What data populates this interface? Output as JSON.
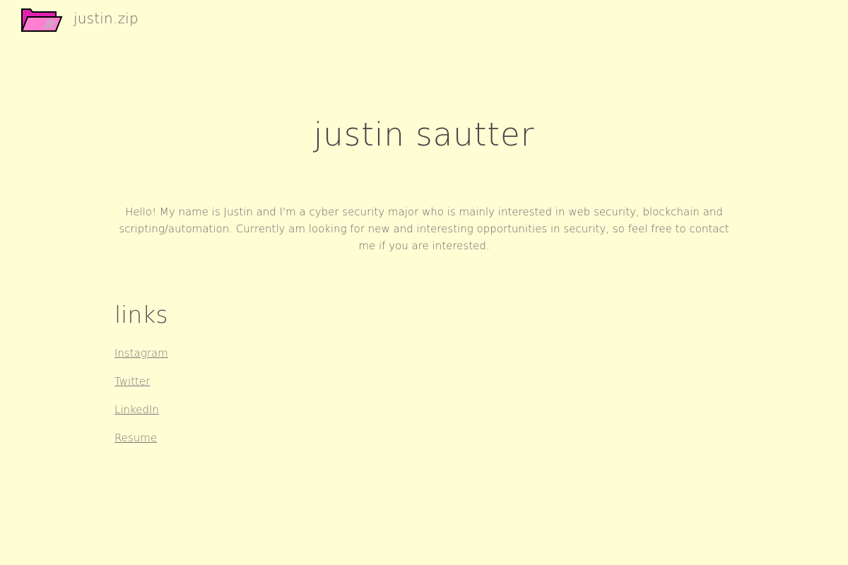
{
  "header": {
    "logo_icon": "open-folder-icon",
    "site_name": "justin.zip"
  },
  "main": {
    "title": "justin sautter",
    "intro": "Hello! My name is Justin and I'm a cyber security major who is mainly interested in web security, blockchain and scripting/automation.  Currently am looking for new and interesting opportunities in security, so feel free to contact me if you are interested.",
    "links_heading": "links",
    "links": [
      {
        "label": "Instagram"
      },
      {
        "label": "Twitter"
      },
      {
        "label": "LinkedIn"
      },
      {
        "label": "Resume"
      }
    ]
  },
  "colors": {
    "background": "#fffdd4",
    "folder_pink": "#ff66cc",
    "folder_magenta": "#e020b0"
  }
}
